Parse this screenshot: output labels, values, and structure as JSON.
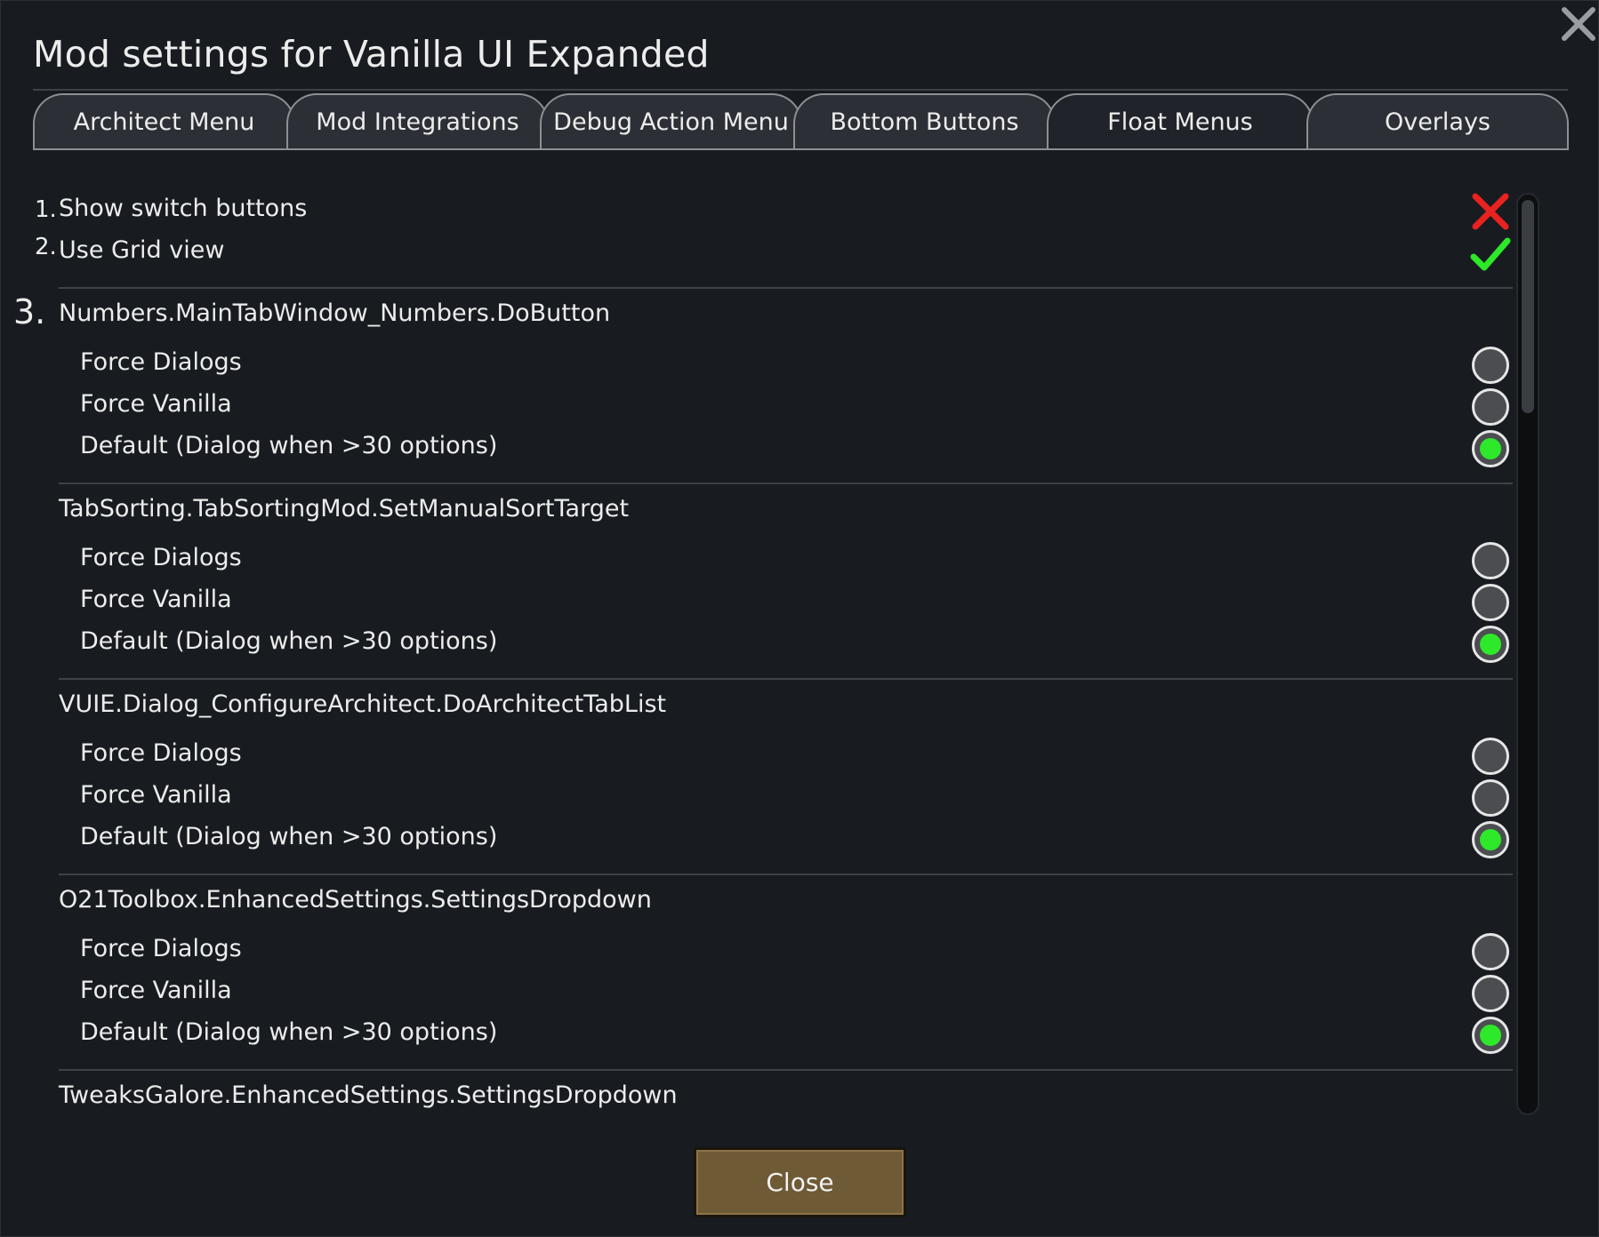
{
  "window": {
    "title": "Mod settings for Vanilla UI Expanded"
  },
  "tabs": [
    {
      "label": "Architect Menu"
    },
    {
      "label": "Mod Integrations"
    },
    {
      "label": "Debug Action Menu"
    },
    {
      "label": "Bottom Buttons"
    },
    {
      "label": "Float Menus",
      "active": true
    },
    {
      "label": "Overlays"
    }
  ],
  "settings": {
    "s1": {
      "number": "1.",
      "label": "Show switch buttons",
      "value": false
    },
    "s2": {
      "number": "2.",
      "label": "Use Grid view",
      "value": true
    },
    "s3_number": "3."
  },
  "groups": [
    {
      "name": "Numbers.MainTabWindow_Numbers.DoButton",
      "options": [
        "Force Dialogs",
        "Force Vanilla",
        "Default (Dialog when >30 options)"
      ],
      "selected": 2
    },
    {
      "name": "TabSorting.TabSortingMod.SetManualSortTarget",
      "options": [
        "Force Dialogs",
        "Force Vanilla",
        "Default (Dialog when >30 options)"
      ],
      "selected": 2
    },
    {
      "name": "VUIE.Dialog_ConfigureArchitect.DoArchitectTabList",
      "options": [
        "Force Dialogs",
        "Force Vanilla",
        "Default (Dialog when >30 options)"
      ],
      "selected": 2
    },
    {
      "name": "O21Toolbox.EnhancedSettings.SettingsDropdown",
      "options": [
        "Force Dialogs",
        "Force Vanilla",
        "Default (Dialog when >30 options)"
      ],
      "selected": 2
    },
    {
      "name": "TweaksGalore.EnhancedSettings.SettingsDropdown"
    }
  ],
  "footer": {
    "close_label": "Close"
  },
  "colors": {
    "background": "#181c21",
    "check_green": "#2ee82a",
    "cross_red": "#e8221e",
    "button_brown": "#6e5a35"
  },
  "icons": {
    "window_close": "close-icon",
    "false_value": "cross-icon",
    "true_value": "check-icon"
  }
}
